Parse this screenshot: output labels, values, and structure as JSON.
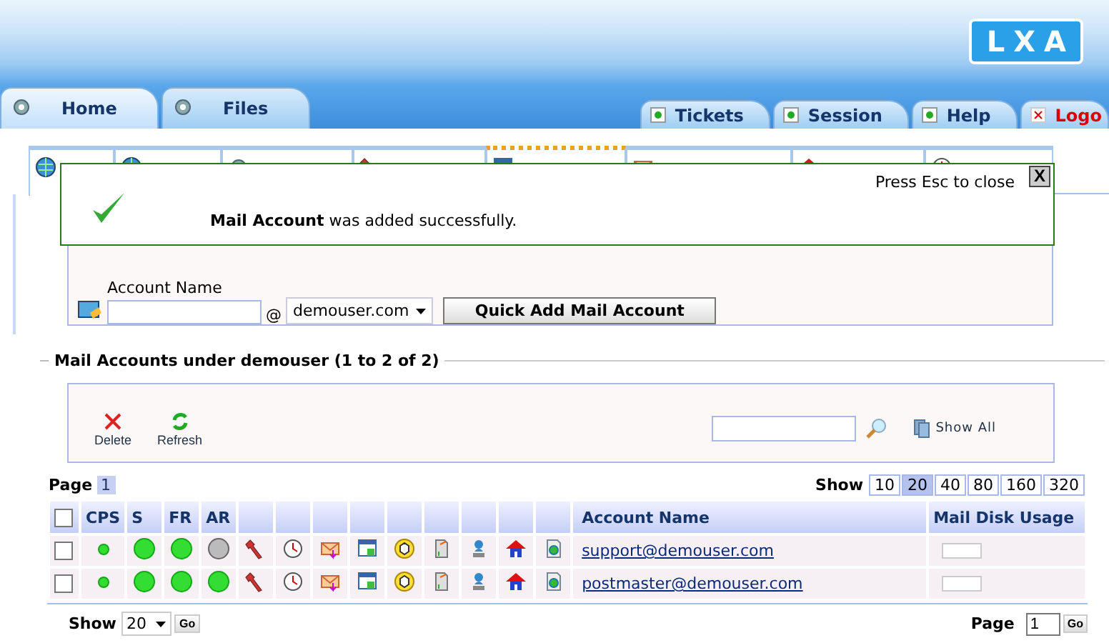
{
  "logo": "LXA",
  "main_tabs": [
    {
      "label": "Home",
      "selected": true,
      "kind": "section"
    },
    {
      "label": "Files",
      "selected": false,
      "kind": "section"
    },
    {
      "label": "Tickets",
      "selected": false,
      "kind": "utility"
    },
    {
      "label": "Session",
      "selected": false,
      "kind": "utility"
    },
    {
      "label": "Help",
      "selected": false,
      "kind": "utility"
    },
    {
      "label": "Logo",
      "selected": false,
      "kind": "logout"
    }
  ],
  "sub_tabs": [
    {
      "selected": false
    },
    {
      "selected": false
    },
    {
      "selected": false
    },
    {
      "selected": false
    },
    {
      "selected": true
    },
    {
      "selected": false
    },
    {
      "selected": false
    },
    {
      "selected": false
    }
  ],
  "notification": {
    "close_hint": "Press Esc to close",
    "close_button": "X",
    "message": "**Mail Account** was added successfully."
  },
  "quick_add": {
    "label": "Account Name",
    "at": "@",
    "domain": "demouser.com",
    "button": "Quick Add Mail Account"
  },
  "section_title": "Mail Accounts under demouser (1 to 2 of 2)",
  "toolbar": {
    "actions": [
      {
        "kind": "delete",
        "label": "Delete"
      },
      {
        "kind": "refresh",
        "label": "Refresh"
      }
    ],
    "show_all": "Show All"
  },
  "paging": {
    "page_label": "Page",
    "pages": [
      {
        "label": "1",
        "selected": true
      }
    ],
    "show_label": "Show",
    "sizes": [
      {
        "label": "10",
        "selected": false
      },
      {
        "label": "20",
        "selected": true
      },
      {
        "label": "40",
        "selected": false
      },
      {
        "label": "80",
        "selected": false
      },
      {
        "label": "160",
        "selected": false
      },
      {
        "label": "320",
        "selected": false
      }
    ]
  },
  "table": {
    "columns": [
      "CPS",
      "S",
      "FR",
      "AR",
      "Account Name",
      "Mail Disk Usage"
    ],
    "header_checked": false,
    "rows": [
      {
        "checked": false,
        "cps": true,
        "s": true,
        "fr": true,
        "ar": false,
        "account": "support@demouser.com",
        "level": 0
      },
      {
        "checked": false,
        "cps": true,
        "s": true,
        "fr": true,
        "ar": true,
        "account": "postmaster@demouser.com",
        "level": 0
      }
    ]
  },
  "footer": {
    "show_label": "Show",
    "show_value": "20",
    "go": "Go",
    "page_label": "Page",
    "page_value": "1",
    "page_go": "Go"
  }
}
